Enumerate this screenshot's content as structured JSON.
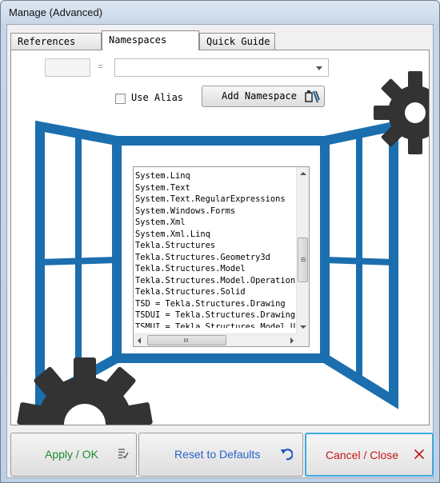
{
  "window": {
    "title": "Manage (Advanced)"
  },
  "tabs": [
    {
      "label": "References",
      "active": false
    },
    {
      "label": "Namespaces",
      "active": true
    },
    {
      "label": "Quick Guide",
      "active": false
    }
  ],
  "namespace_form": {
    "alias_value": "",
    "equals_sign": "=",
    "namespace_value": "",
    "use_alias_label": "Use Alias",
    "use_alias_checked": false,
    "add_namespace_label": "Add Namespace"
  },
  "namespaces_list": [
    "System.Linq",
    "System.Text",
    "System.Text.RegularExpressions",
    "System.Windows.Forms",
    "System.Xml",
    "System.Xml.Linq",
    "Tekla.Structures",
    "Tekla.Structures.Geometry3d",
    "Tekla.Structures.Model",
    "Tekla.Structures.Model.Operations",
    "Tekla.Structures.Solid",
    "TSD = Tekla.Structures.Drawing",
    "TSDUI = Tekla.Structures.Drawing.UI",
    "TSMUI = Tekla.Structures.Model.UI"
  ],
  "footer": {
    "apply_label": "Apply / OK",
    "reset_label": "Reset to Defaults",
    "cancel_label": "Cancel / Close"
  },
  "colors": {
    "illustration_blue": "#1b6fae",
    "gear": "#333333",
    "apply_text": "#1e8a2f",
    "reset_text": "#2a62c9",
    "cancel_text": "#c41818",
    "focus_border": "#3da9df"
  },
  "icons": [
    "tools-icon",
    "gear-icon",
    "list-check-icon",
    "undo-icon",
    "close-x-icon"
  ]
}
